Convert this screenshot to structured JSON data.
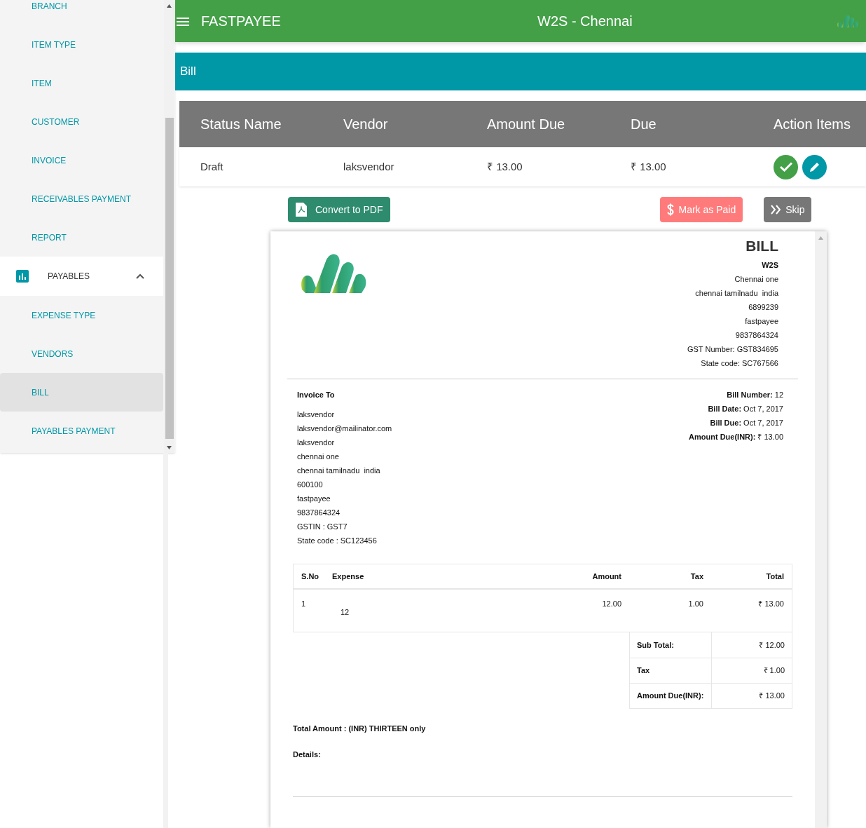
{
  "sidebar": {
    "items": [
      {
        "kind": "link",
        "label": "BRANCH",
        "selected": false
      },
      {
        "kind": "link",
        "label": "ITEM TYPE",
        "selected": false
      },
      {
        "kind": "link",
        "label": "ITEM",
        "selected": false
      },
      {
        "kind": "link",
        "label": "CUSTOMER",
        "selected": false
      },
      {
        "kind": "link",
        "label": "INVOICE",
        "selected": false
      },
      {
        "kind": "link",
        "label": "RECEIVABLES PAYMENT",
        "selected": false
      },
      {
        "kind": "link",
        "label": "REPORT",
        "selected": false
      },
      {
        "kind": "group",
        "label": "PAYABLES",
        "expanded": true,
        "children": [
          {
            "label": "EXPENSE TYPE",
            "selected": false
          },
          {
            "label": "VENDORS",
            "selected": false
          },
          {
            "label": "BILL",
            "selected": true
          },
          {
            "label": "PAYABLES PAYMENT",
            "selected": false
          }
        ]
      }
    ]
  },
  "header": {
    "app_name": "FASTPAYEE",
    "branch": "W2S - Chennai"
  },
  "page_title": "Bill",
  "table": {
    "columns": [
      "Status Name",
      "Vendor",
      "Amount Due",
      "Due",
      "Action Items"
    ],
    "rows": [
      {
        "status": "Draft",
        "vendor": "laksvendor",
        "amount_due": "₹ 13.00",
        "due": "₹ 13.00"
      }
    ]
  },
  "actions": {
    "convert": "Convert to PDF",
    "mark_paid": "Mark as Paid",
    "skip": "Skip"
  },
  "bill": {
    "title": "BILL",
    "company": [
      "W2S",
      "Chennai one",
      "chennai tamilnadu  india",
      "6899239",
      "fastpayee",
      "9837864324",
      "GST Number: GST834695",
      "State code: SC767566"
    ],
    "invoice_to_label": "Invoice To",
    "invoice_to": [
      "laksvendor",
      "laksvendor@mailinator.com",
      "laksvendor",
      "chennai one",
      "chennai tamilnadu  india",
      "600100",
      "fastpayee",
      "9837864324",
      "GSTIN : GST7",
      "State code : SC123456"
    ],
    "meta": [
      "**Bill Number:** 12",
      "**Bill Date:** Oct 7, 2017",
      "**Bill Due:** Oct 7, 2017",
      "**Amount Due(INR):** ₹ 13.00"
    ],
    "lines": {
      "columns": [
        "S.No",
        "Expense",
        "Amount",
        "Tax",
        "Total"
      ],
      "rows": [
        [
          "1",
          "12",
          "12.00",
          "1.00",
          "₹ 13.00"
        ]
      ]
    },
    "totals": [
      {
        "label": "Sub Total:",
        "value": "₹ 12.00"
      },
      {
        "label": "Tax",
        "value": "₹ 1.00"
      },
      {
        "label": "Amount Due(INR):",
        "value": "₹ 13.00"
      }
    ],
    "total_words": "Total Amount : (INR) THIRTEEN only",
    "details_label": "Details:"
  }
}
